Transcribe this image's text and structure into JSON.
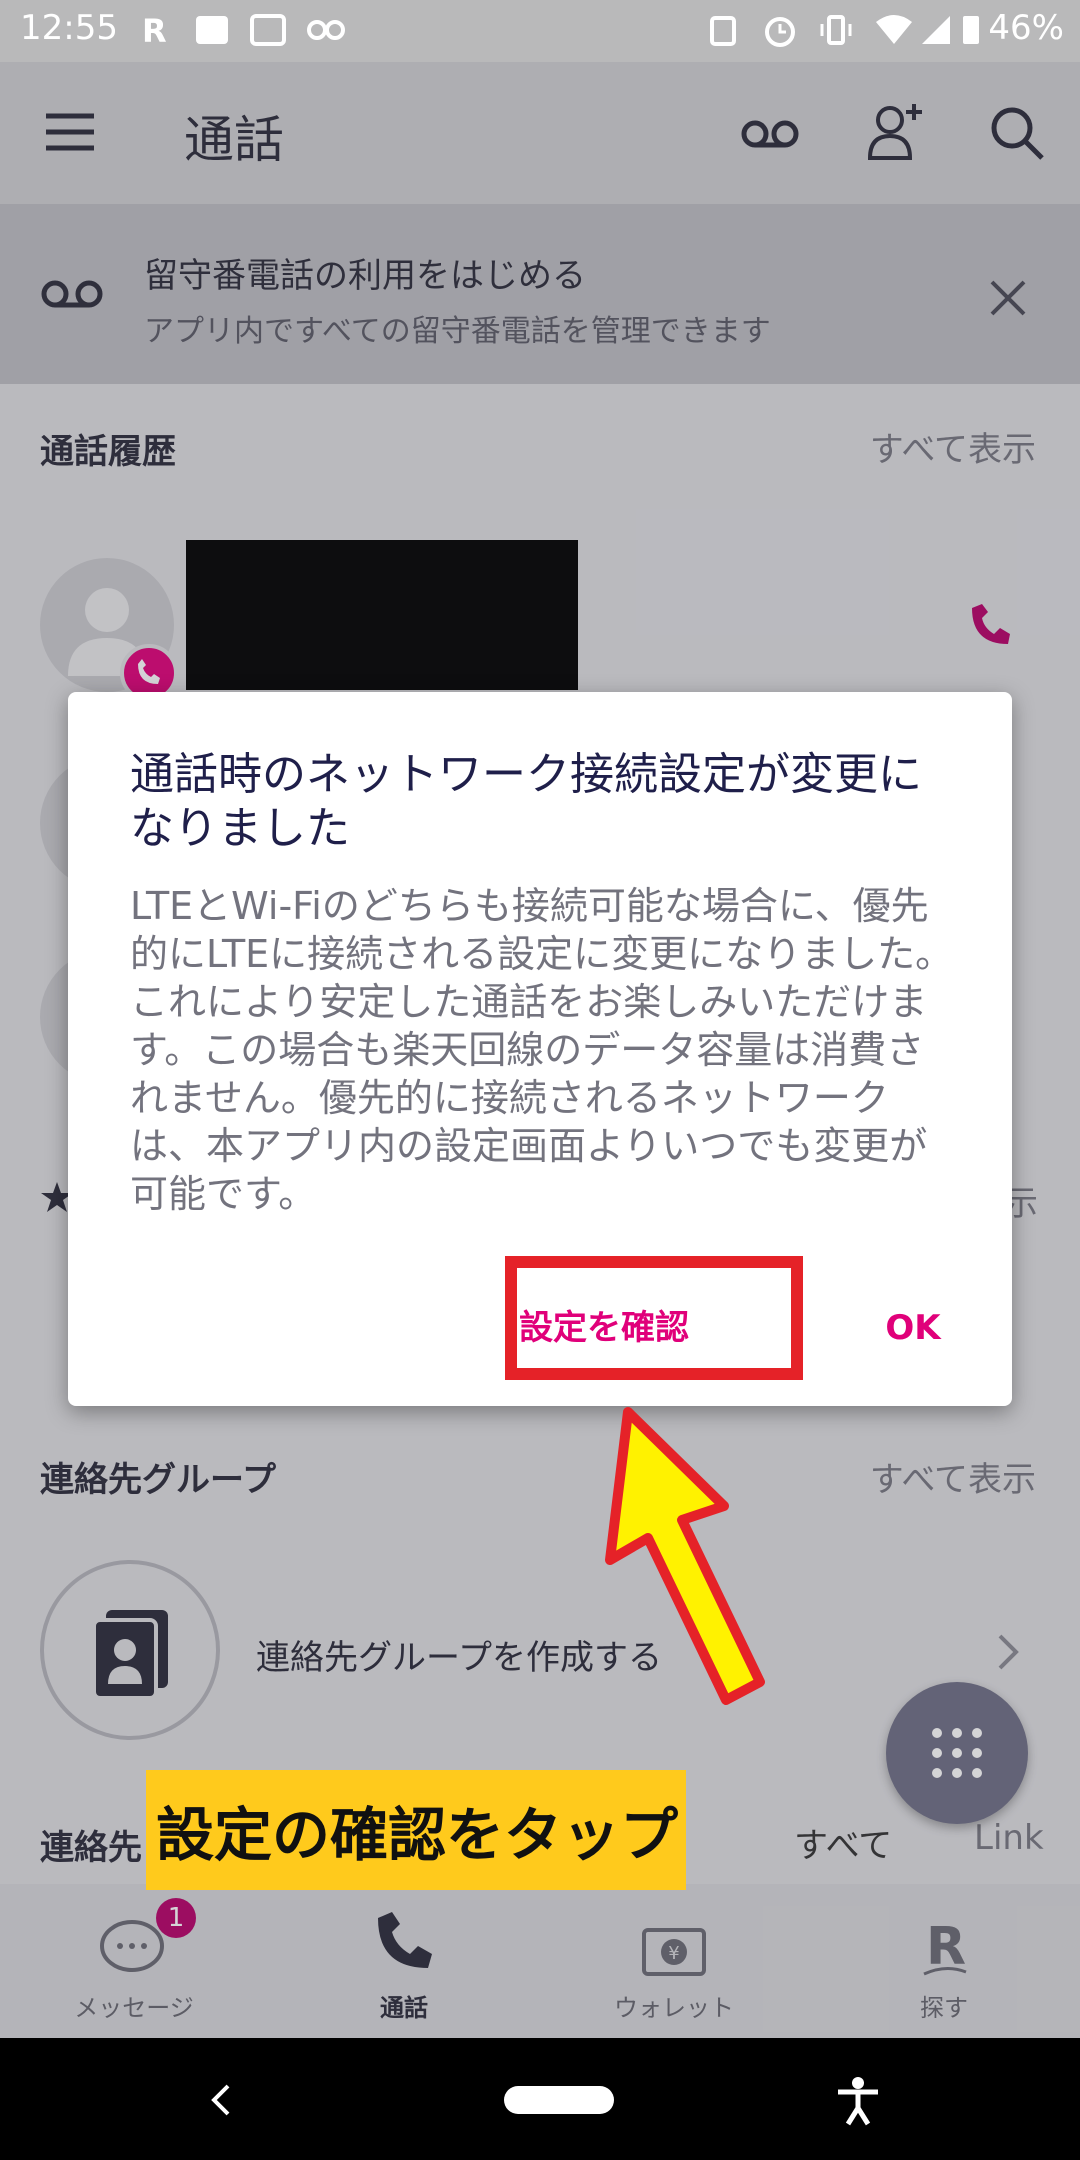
{
  "status_bar": {
    "time": "12:55",
    "battery": "46%"
  },
  "app_bar": {
    "title": "通話"
  },
  "banner": {
    "title": "留守番電話の利用をはじめる",
    "subtitle": "アプリ内ですべての留守番電話を管理できます"
  },
  "sections": {
    "history": {
      "title": "通話履歴",
      "see_all": "すべて表示"
    },
    "groups": {
      "title": "連絡先グループ",
      "see_all": "すべて表示",
      "create_label": "連絡先グループを作成する"
    },
    "favorites_partial": "示",
    "contacts": {
      "title_partial": "連絡先",
      "see_all_partial": "すべて",
      "link_partial": "Link"
    }
  },
  "dialog": {
    "title": "通話時のネットワーク接続設定が変更になりました",
    "body": "LTEとWi-Fiのどちらも接続可能な場合に、優先的にLTEに接続される設定に変更になりました。これにより安定した通話をお楽しみいただけます。この場合も楽天回線のデータ容量は消費されません。優先的に接続されるネットワークは、本アプリ内の設定画面よりいつでも変更が可能です。",
    "settings_button": "設定を確認",
    "ok_button": "OK"
  },
  "caption": "設定の確認をタップ",
  "bottom_nav": {
    "items": [
      {
        "label": "メッセージ",
        "badge": "1"
      },
      {
        "label": "通話"
      },
      {
        "label": "ウォレット"
      },
      {
        "label": "探す"
      }
    ]
  },
  "colors": {
    "accent": "#e0007a",
    "highlight_box": "#e52228",
    "caption_bg": "#ffca1c",
    "arrow": "#fff200"
  }
}
